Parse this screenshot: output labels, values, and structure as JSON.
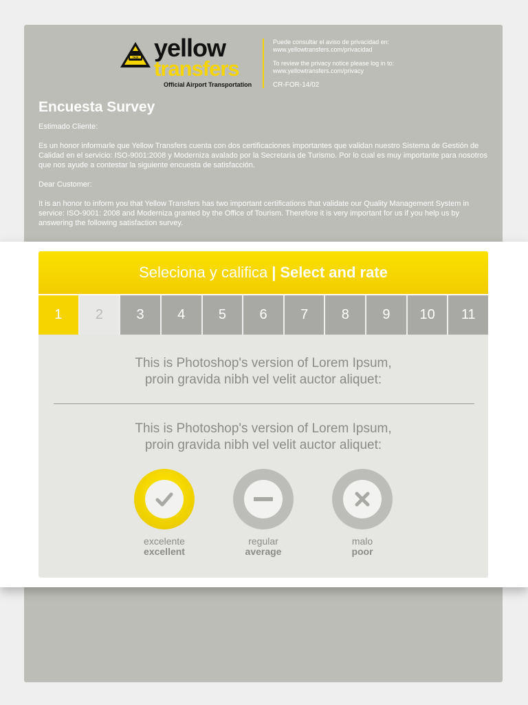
{
  "brand": {
    "name_top": "yellow",
    "name_bottom": "transfers",
    "tagline": "Official Airport Transportation",
    "badge_text": "TAXI"
  },
  "privacy": {
    "es_line": "Puede consultar el aviso de privacidad en:",
    "es_url": "www.yellowtransfers.com/privacidad",
    "en_line": "To review the privacy notice please log in to:",
    "en_url": "www.yellowtransfers.com/privacy",
    "code": "CR-FOR-14/02"
  },
  "survey": {
    "title": "Encuesta Survey",
    "greeting_es": "Estimado Cliente:",
    "body_es": "Es un honor informarle que Yellow Transfers cuenta con dos certificaciones importantes que validan nuestro Sistema de Gestión de Calidad en el servicio: ISO-9001:2008 y Moderniza avalado por la Secretaria de Turismo. Por lo cual es muy importante para nosotros que nos ayude a contestar la siguiente encuesta de satisfacción.",
    "greeting_en": "Dear Customer:",
    "body_en": "It is an honor to inform you that Yellow Transfers has two important certifications that validate our Quality Management System in service: ISO-9001: 2008 and Moderniza granted by the Office of Tourism. Therefore it is very important for us if you help us by answering the following satisfaction survey."
  },
  "rating": {
    "header_es": "Seleciona y califica",
    "header_sep": "|",
    "header_en": "Select and rate",
    "tabs": [
      "1",
      "2",
      "3",
      "4",
      "5",
      "6",
      "7",
      "8",
      "9",
      "10",
      "11"
    ],
    "active_tab": "1",
    "question_1_line1": "This is Photoshop's version  of Lorem Ipsum,",
    "question_1_line2": "proin gravida nibh vel velit auctor aliquet:",
    "question_2_line1": "This is Photoshop's version  of Lorem Ipsum,",
    "question_2_line2": "proin gravida nibh vel velit auctor aliquet:",
    "options": [
      {
        "es": "excelente",
        "en": "excellent",
        "icon": "check-icon",
        "selected": true
      },
      {
        "es": "regular",
        "en": "average",
        "icon": "minus-icon",
        "selected": false
      },
      {
        "es": "malo",
        "en": "poor",
        "icon": "x-icon",
        "selected": false
      }
    ]
  },
  "colors": {
    "accent": "#f5d400",
    "sheet": "#bdbdb8",
    "tab": "#a8a8a5",
    "card": "#e6e6e3"
  }
}
